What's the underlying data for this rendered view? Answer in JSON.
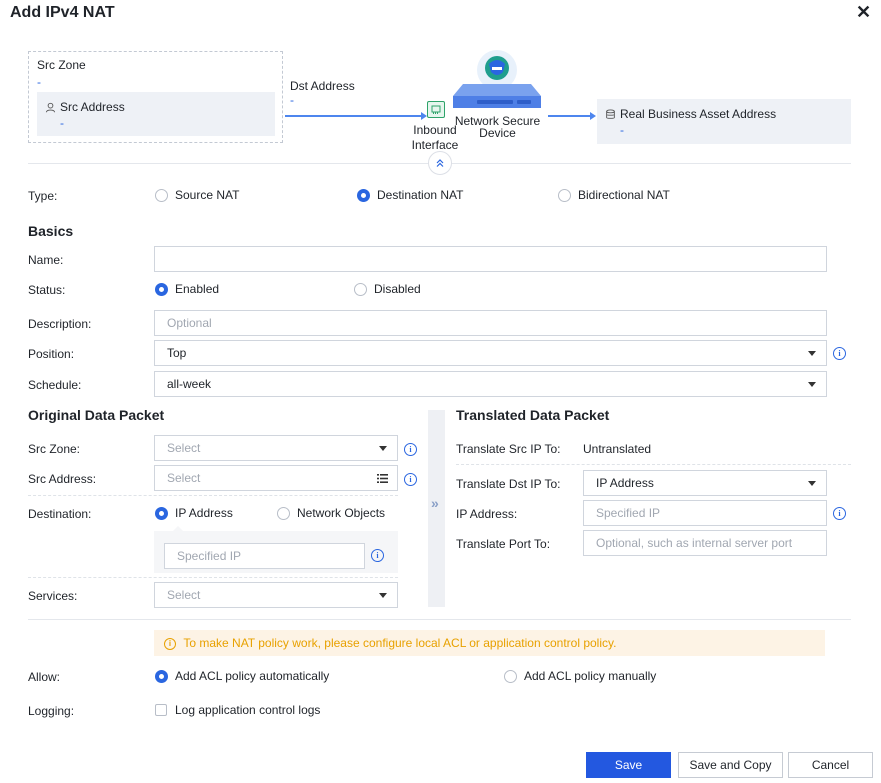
{
  "dialog": {
    "title": "Add IPv4 NAT"
  },
  "diagram": {
    "src_zone_label": "Src Zone",
    "src_zone_value": "-",
    "src_address_label": "Src Address",
    "src_address_value": "-",
    "dst_address_label": "Dst Address",
    "dst_address_value": "-",
    "inbound_interface_label_1": "Inbound",
    "inbound_interface_label_2": "Interface",
    "device_label_1": "Network Secure",
    "device_label_2": "Device",
    "real_asset_label": "Real Business Asset Address",
    "real_asset_value": "-"
  },
  "type": {
    "label": "Type:",
    "options": [
      "Source NAT",
      "Destination NAT",
      "Bidirectional NAT"
    ],
    "selected": "Destination NAT"
  },
  "basics": {
    "heading": "Basics",
    "name_label": "Name:",
    "name_value": "",
    "status_label": "Status:",
    "status_enabled": "Enabled",
    "status_disabled": "Disabled",
    "status_selected": "Enabled",
    "description_label": "Description:",
    "description_placeholder": "Optional",
    "position_label": "Position:",
    "position_value": "Top",
    "schedule_label": "Schedule:",
    "schedule_value": "all-week"
  },
  "original": {
    "heading": "Original Data Packet",
    "src_zone_label": "Src Zone:",
    "src_zone_placeholder": "Select",
    "src_address_label": "Src Address:",
    "src_address_placeholder": "Select",
    "destination_label": "Destination:",
    "destination_ip": "IP Address",
    "destination_objects": "Network Objects",
    "destination_selected": "IP Address",
    "specified_ip_placeholder": "Specified IP",
    "services_label": "Services:",
    "services_placeholder": "Select"
  },
  "translated": {
    "heading": "Translated Data Packet",
    "src_ip_label": "Translate Src IP To:",
    "src_ip_value": "Untranslated",
    "dst_ip_label": "Translate Dst IP To:",
    "dst_ip_value": "IP Address",
    "ip_address_label": "IP Address:",
    "ip_address_placeholder": "Specified IP",
    "port_label": "Translate Port To:",
    "port_placeholder": "Optional, such as internal server port"
  },
  "warning": {
    "text": "To make NAT policy work, please configure local ACL or application control policy."
  },
  "allow": {
    "label": "Allow:",
    "auto": "Add ACL policy automatically",
    "manual": "Add ACL policy manually",
    "selected": "Add ACL policy automatically"
  },
  "logging": {
    "label": "Logging:",
    "checkbox_label": "Log application control logs",
    "checked": false
  },
  "footer": {
    "save": "Save",
    "save_and_copy": "Save and Copy",
    "cancel": "Cancel"
  },
  "colors": {
    "primary": "#2358e0",
    "accent_blue": "#2a66e0",
    "warning_text": "#e8a100",
    "warning_bg": "#fdf3e5",
    "panel_bg": "#eef1f6"
  }
}
